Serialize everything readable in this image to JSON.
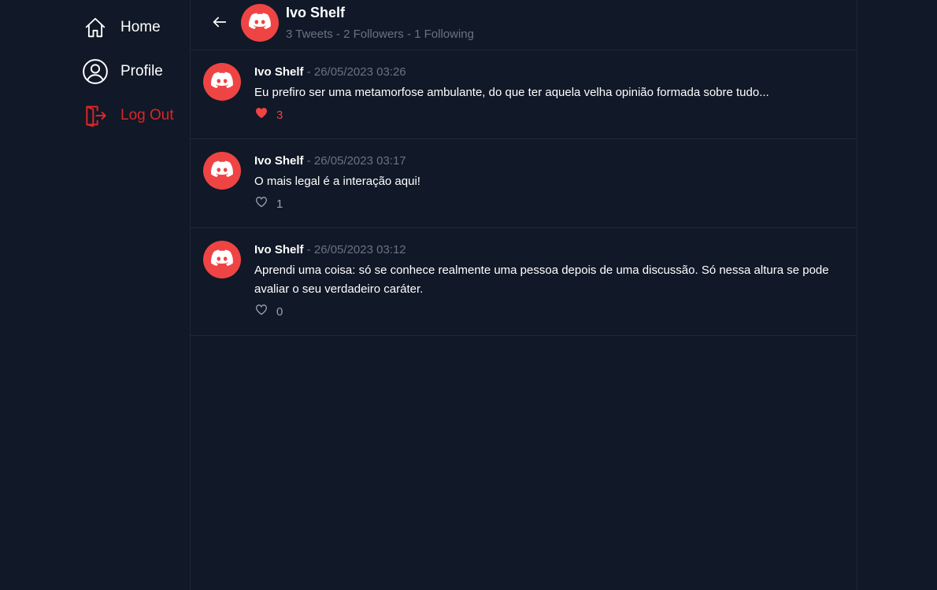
{
  "sidebar": {
    "items": [
      {
        "label": "Home",
        "icon": "home-icon"
      },
      {
        "label": "Profile",
        "icon": "user-circle-icon"
      },
      {
        "label": "Log Out",
        "icon": "logout-icon"
      }
    ]
  },
  "header": {
    "name": "Ivo Shelf",
    "stats": "3 Tweets - 2 Followers - 1 Following",
    "back_icon": "arrow-left-icon",
    "avatar_icon": "discord-logo-icon"
  },
  "tweets": [
    {
      "author": "Ivo Shelf",
      "separator": " - ",
      "date": "26/05/2023 03:26",
      "text": "Eu prefiro ser uma metamorfose ambulante, do que ter aquela velha opinião formada sobre tudo...",
      "likes": "3",
      "liked": true
    },
    {
      "author": "Ivo Shelf",
      "separator": " - ",
      "date": "26/05/2023 03:17",
      "text": "O mais legal é a interação aqui!",
      "likes": "1",
      "liked": false
    },
    {
      "author": "Ivo Shelf",
      "separator": " - ",
      "date": "26/05/2023 03:12",
      "text": "Aprendi uma coisa: só se conhece realmente uma pessoa depois de uma discussão. Só nessa altura se pode avaliar o seu verdadeiro caráter.",
      "likes": "0",
      "liked": false
    }
  ],
  "colors": {
    "background": "#111827",
    "accent": "#ef4444",
    "logout": "#dc2626",
    "muted": "#6b7280",
    "divider": "#1f2937"
  }
}
